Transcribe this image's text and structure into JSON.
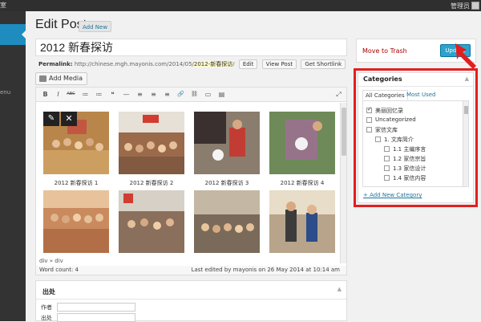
{
  "adminbar": {
    "left_fragment": "室",
    "user_label": "管理员"
  },
  "sidebar": {
    "collapse_label": "enu"
  },
  "header": {
    "title": "Edit Post",
    "add_new": "Add New"
  },
  "post": {
    "title": "2012 新春探访"
  },
  "permalink": {
    "label": "Permalink:",
    "base": "http://chinese.mgh.mayonis.com/2014/05/",
    "slug": "2012-新春探访",
    "trail": "/",
    "edit": "Edit",
    "view": "View Post",
    "shortlink": "Get Shortlink"
  },
  "add_media": "Add Media",
  "toolbar": {
    "bold": "B",
    "italic": "I",
    "strike": "ABC",
    "bullets": "≔",
    "numbers": "≔",
    "quote": "❝",
    "hr": "—",
    "align_left": "≡",
    "align_center": "≡",
    "align_right": "≡",
    "link": "🔗",
    "unlink": "⛓",
    "more": "▭",
    "kitchen": "▤",
    "fullscreen": "⤢"
  },
  "colors": {
    "accent": "#2ea2cc",
    "highlight": "#e21f1f",
    "link": "#21759b",
    "trash": "#aa0000"
  },
  "gallery": {
    "edit_icon": "✎",
    "close_icon": "✕",
    "items": [
      {
        "caption": "2012 新春探访 1",
        "color": "#b8864a"
      },
      {
        "caption": "2012 新春探访 2",
        "color": "#9a6a4a"
      },
      {
        "caption": "2012 新春探访 3",
        "color": "#8a7d6e"
      },
      {
        "caption": "2012 新春探访 4",
        "color": "#6e8a58"
      },
      {
        "caption": "",
        "color": "#c98a5e"
      },
      {
        "caption": "",
        "color": "#8a6f5c"
      },
      {
        "caption": "",
        "color": "#7a6a5a"
      },
      {
        "caption": "",
        "color": "#b7a48a"
      }
    ]
  },
  "path": "div » div",
  "status": {
    "word_count": "Word count: 4",
    "last_edited": "Last edited by mayonis on 26 May 2014 at 10:14 am"
  },
  "metabox": {
    "title": "出处",
    "fields": [
      {
        "label": "作者"
      },
      {
        "label": "出处"
      }
    ]
  },
  "publish": {
    "trash": "Move to Trash",
    "update": "Update"
  },
  "categories": {
    "title": "Categories",
    "tab_all": "All Categories",
    "tab_used": "Most Used",
    "items": [
      {
        "label": "美丽回忆录",
        "checked": true
      },
      {
        "label": "Uncategorized",
        "checked": false
      },
      {
        "label": "家信文库",
        "checked": false
      },
      {
        "label": "1. 文库简介",
        "checked": false
      },
      {
        "label": "1.1 主编序言",
        "checked": false
      },
      {
        "label": "1.2 家信宗旨",
        "checked": false
      },
      {
        "label": "1.3 家信设计",
        "checked": false
      },
      {
        "label": "1.4 家信内容",
        "checked": false
      }
    ],
    "add_new": "+ Add New Category"
  }
}
